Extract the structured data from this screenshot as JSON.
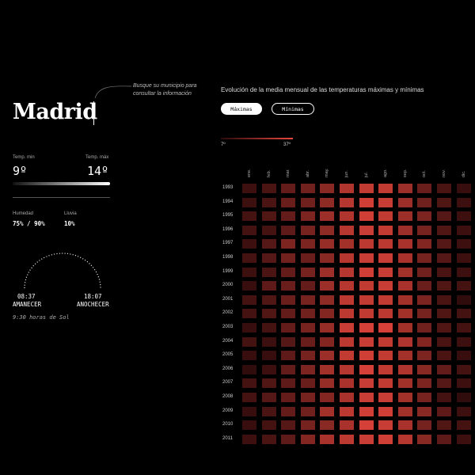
{
  "hint": "Busque su municipio para consultar la información",
  "city": "Madrid",
  "temps": {
    "min_label": "Temp. min",
    "min_value": "9º",
    "max_label": "Temp. máx",
    "max_value": "14º"
  },
  "humidity": {
    "label": "Humedad",
    "value": "75% / 90%"
  },
  "rain": {
    "label": "Lluvia",
    "value": "10%"
  },
  "sun": {
    "sunrise_time": "08:37",
    "sunrise_label": "AMANECER",
    "sunset_time": "18:07",
    "sunset_label": "ANOCHECER",
    "hours": "9:30 horas de Sol"
  },
  "chart": {
    "title": "Evolución de la media mensual de las temperaturas máximas y mínimas",
    "tab_max": "Máximas",
    "tab_min": "Mínimas",
    "scale_min": "7º",
    "scale_max": "37º"
  },
  "colors": {
    "low": "#2a0a0a",
    "high": "#e8473d"
  },
  "chart_data": {
    "type": "heatmap",
    "title": "Evolución de la media mensual de las temperaturas máximas y mínimas",
    "categories": [
      "ene.",
      "feb.",
      "mar.",
      "abr.",
      "may.",
      "jun.",
      "jul.",
      "ago.",
      "sep.",
      "oct.",
      "nov.",
      "dic."
    ],
    "years": [
      "1993",
      "1994",
      "1995",
      "1996",
      "1997",
      "1998",
      "1999",
      "2000",
      "2001",
      "2002",
      "2003",
      "2004",
      "2005",
      "2006",
      "2007",
      "2008",
      "2009",
      "2010",
      "2011"
    ],
    "scale": [
      7,
      37
    ],
    "values": [
      [
        10,
        12,
        16,
        18,
        22,
        28,
        31,
        31,
        25,
        17,
        12,
        9
      ],
      [
        10,
        12,
        17,
        18,
        23,
        29,
        33,
        32,
        25,
        18,
        13,
        10
      ],
      [
        11,
        13,
        16,
        20,
        25,
        28,
        33,
        31,
        25,
        20,
        14,
        10
      ],
      [
        11,
        11,
        15,
        19,
        23,
        29,
        32,
        31,
        25,
        19,
        13,
        10
      ],
      [
        10,
        14,
        20,
        20,
        24,
        26,
        30,
        30,
        27,
        21,
        14,
        10
      ],
      [
        11,
        14,
        18,
        17,
        22,
        29,
        32,
        32,
        27,
        19,
        14,
        10
      ],
      [
        10,
        12,
        16,
        19,
        25,
        29,
        33,
        32,
        26,
        18,
        12,
        10
      ],
      [
        9,
        15,
        17,
        16,
        25,
        29,
        31,
        32,
        27,
        17,
        13,
        11
      ],
      [
        11,
        13,
        17,
        19,
        23,
        30,
        31,
        31,
        26,
        20,
        12,
        8
      ],
      [
        11,
        13,
        16,
        18,
        21,
        30,
        31,
        30,
        26,
        19,
        13,
        11
      ],
      [
        9,
        11,
        16,
        19,
        24,
        32,
        34,
        34,
        26,
        18,
        13,
        11
      ],
      [
        11,
        10,
        14,
        17,
        21,
        30,
        32,
        31,
        28,
        21,
        12,
        10
      ],
      [
        9,
        9,
        15,
        19,
        25,
        31,
        33,
        31,
        26,
        20,
        12,
        9
      ],
      [
        8,
        10,
        16,
        20,
        26,
        29,
        34,
        31,
        28,
        22,
        16,
        11
      ],
      [
        11,
        13,
        15,
        17,
        24,
        27,
        32,
        31,
        26,
        20,
        14,
        10
      ],
      [
        11,
        14,
        16,
        19,
        21,
        27,
        32,
        32,
        26,
        19,
        11,
        8
      ],
      [
        9,
        12,
        16,
        18,
        26,
        30,
        33,
        33,
        26,
        22,
        15,
        10
      ],
      [
        9,
        11,
        14,
        19,
        22,
        27,
        34,
        32,
        27,
        19,
        13,
        11
      ],
      [
        10,
        12,
        15,
        21,
        27,
        30,
        32,
        33,
        29,
        22,
        15,
        10
      ]
    ]
  }
}
